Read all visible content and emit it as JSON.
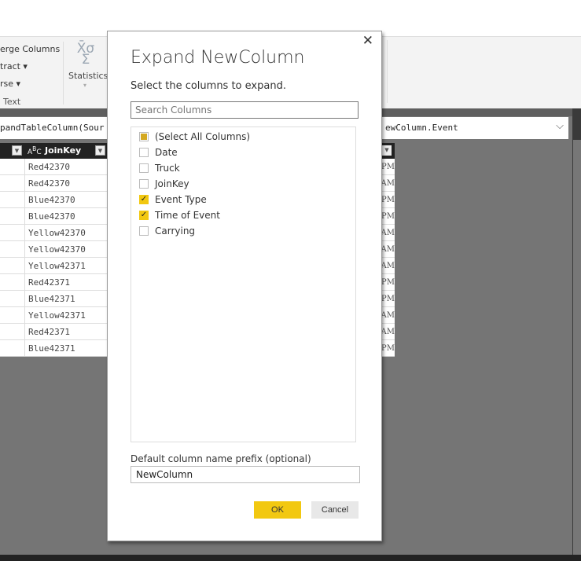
{
  "ribbon": {
    "merge_columns": "erge Columns",
    "extract": "tract ▾",
    "parse": "rse ▾",
    "group_text": "Text",
    "statistics_icon": "ΧΣ",
    "statistics": "Statistics"
  },
  "formula": {
    "left": "pandTableColumn(Sour",
    "right": "ewColumn.Event"
  },
  "table": {
    "column_header": "JoinKey",
    "type_icon": "ABC",
    "rows": [
      "Red42370",
      "Red42370",
      "Blue42370",
      "Blue42370",
      "Yellow42370",
      "Yellow42370",
      "Yellow42371",
      "Red42371",
      "Blue42371",
      "Yellow42371",
      "Red42371",
      "Blue42371"
    ],
    "time_suffixes": [
      "PM",
      "AM",
      "PM",
      "PM",
      "AM",
      "AM",
      "AM",
      "PM",
      "PM",
      "AM",
      "AM",
      "PM"
    ]
  },
  "dialog": {
    "title": "Expand NewColumn",
    "subtitle": "Select the columns to expand.",
    "search_placeholder": "Search Columns",
    "columns": [
      {
        "label": "(Select All Columns)",
        "state": "partial"
      },
      {
        "label": "Date",
        "state": "unchecked"
      },
      {
        "label": "Truck",
        "state": "unchecked"
      },
      {
        "label": "JoinKey",
        "state": "unchecked"
      },
      {
        "label": "Event Type",
        "state": "checked"
      },
      {
        "label": "Time of Event",
        "state": "checked"
      },
      {
        "label": "Carrying",
        "state": "unchecked"
      }
    ],
    "prefix_label": "Default column name prefix (optional)",
    "prefix_value": "NewColumn",
    "ok": "OK",
    "cancel": "Cancel",
    "close": "✕"
  },
  "colors": {
    "accent": "#f2c811",
    "background": "#757575"
  }
}
